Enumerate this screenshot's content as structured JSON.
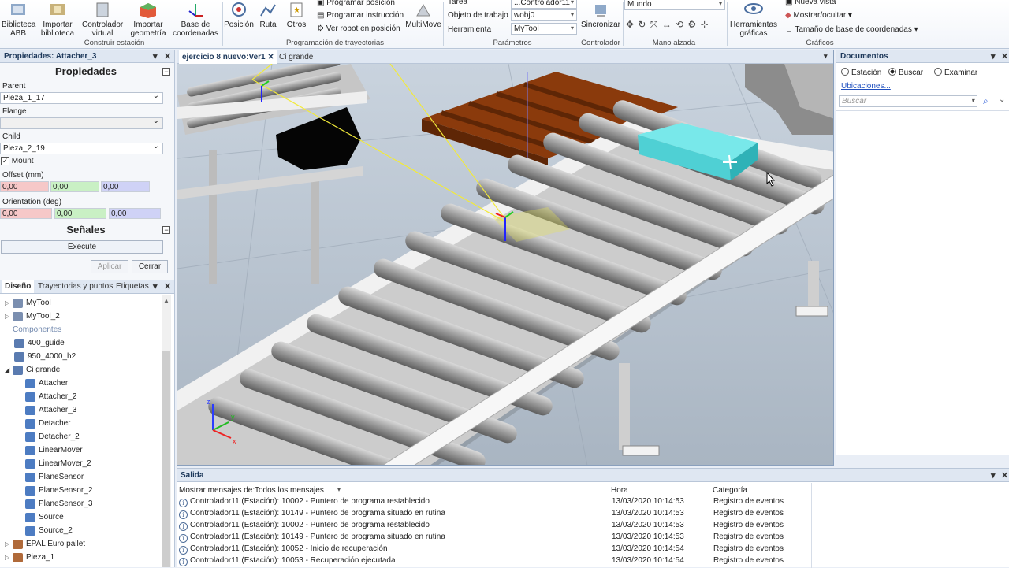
{
  "ribbon": {
    "biblioteca_abb": "Biblioteca ABB",
    "importar_biblioteca": "Importar biblioteca",
    "controlador_virtual": "Controlador virtual",
    "importar_geometria": "Importar geometría",
    "base_coordenadas": "Base de coordenadas",
    "construir_estacion": "Construir estación",
    "posicion": "Posición",
    "ruta": "Ruta",
    "otros": "Otros",
    "programar_posicion": "Programar posición",
    "programar_instruccion": "Programar instrucción",
    "ver_robot": "Ver robot en posición",
    "multimove": "MultiMove",
    "programacion_trayectorias": "Programación de trayectorias",
    "tarea_label": "Tarea",
    "tarea_value": "...Controlador11",
    "objeto_label": "Objeto de trabajo",
    "objeto_value": "wobj0",
    "herramienta_label": "Herramienta",
    "herramienta_value": "MyTool",
    "parametros": "Parámetros",
    "sincronizar": "Sincronizar",
    "controlador": "Controlador",
    "mundo": "Mundo",
    "mano_alzada": "Mano alzada",
    "herramientas_graficas": "Herramientas gráficas",
    "nueva_vista": "Nueva vista",
    "mostrar_ocultar": "Mostrar/ocultar",
    "tamano_base": "Tamaño de base de coordenadas",
    "graficos": "Gráficos"
  },
  "properties": {
    "header": "Propiedades: Attacher_3",
    "title": "Propiedades",
    "parent_label": "Parent",
    "parent_value": "Pieza_1_17",
    "flange_label": "Flange",
    "flange_value": "",
    "child_label": "Child",
    "child_value": "Pieza_2_19",
    "mount_label": "Mount",
    "offset_label": "Offset (mm)",
    "offset": [
      "0,00",
      "0,00",
      "0,00"
    ],
    "orientation_label": "Orientation (deg)",
    "orientation": [
      "0,00",
      "0,00",
      "0,00"
    ],
    "senales": "Señales",
    "execute": "Execute",
    "aplicar": "Aplicar",
    "cerrar": "Cerrar"
  },
  "tree": {
    "tabs": [
      "Diseño",
      "Trayectorias y puntos",
      "Etiquetas"
    ],
    "items": [
      "MyTool",
      "MyTool_2",
      "Componentes",
      "400_guide",
      "950_4000_h2",
      "Ci grande",
      "Attacher",
      "Attacher_2",
      "Attacher_3",
      "Detacher",
      "Detacher_2",
      "LinearMover",
      "LinearMover_2",
      "PlaneSensor",
      "PlaneSensor_2",
      "PlaneSensor_3",
      "Source",
      "Source_2",
      "EPAL Euro pallet",
      "Pieza_1"
    ]
  },
  "viewport": {
    "tabs": [
      "ejercicio 8 nuevo:Ver1",
      "Ci grande"
    ],
    "axes": [
      "z",
      "y",
      "x"
    ]
  },
  "documents": {
    "header": "Documentos",
    "radio": [
      "Estación",
      "Buscar",
      "Examinar"
    ],
    "ubicaciones": "Ubicaciones...",
    "buscar_placeholder": "Buscar"
  },
  "output": {
    "header": "Salida",
    "mostrar_label": "Mostrar mensajes de:",
    "mostrar_value": "Todos los mensajes",
    "col_hora": "Hora",
    "col_categoria": "Categoría",
    "rows": [
      {
        "msg": "Controlador11 (Estación): 10002 - Puntero de programa restablecido",
        "hora": "13/03/2020 10:14:53",
        "cat": "Registro de eventos"
      },
      {
        "msg": "Controlador11 (Estación): 10149 - Puntero de programa situado en rutina",
        "hora": "13/03/2020 10:14:53",
        "cat": "Registro de eventos"
      },
      {
        "msg": "Controlador11 (Estación): 10002 - Puntero de programa restablecido",
        "hora": "13/03/2020 10:14:53",
        "cat": "Registro de eventos"
      },
      {
        "msg": "Controlador11 (Estación): 10149 - Puntero de programa situado en rutina",
        "hora": "13/03/2020 10:14:53",
        "cat": "Registro de eventos"
      },
      {
        "msg": "Controlador11 (Estación): 10052 - Inicio de recuperación",
        "hora": "13/03/2020 10:14:54",
        "cat": "Registro de eventos"
      },
      {
        "msg": "Controlador11 (Estación): 10053 - Recuperación ejecutada",
        "hora": "13/03/2020 10:14:54",
        "cat": "Registro de eventos"
      }
    ]
  }
}
